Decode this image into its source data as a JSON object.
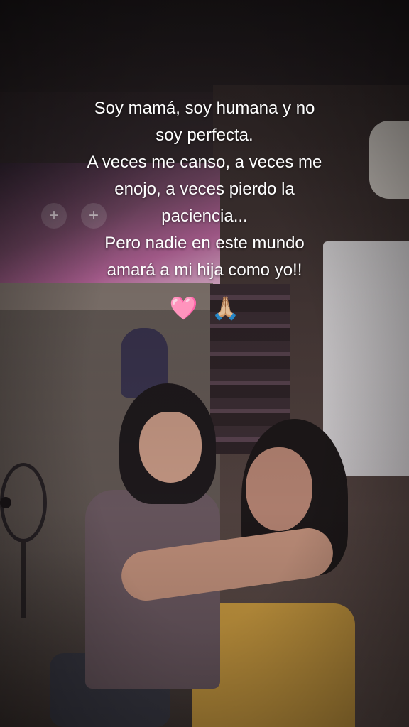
{
  "caption": {
    "lines": [
      "Soy mamá, soy humana y no",
      "soy perfecta.",
      "A veces me canso, a veces me",
      "enojo, a veces pierdo la",
      "paciencia...",
      "Pero nadie en este mundo",
      "amará a mi hija como yo!!"
    ]
  },
  "emojis": {
    "heart": "🩷",
    "hands": "🙏🏼",
    "heart_icon": "pink-heart-icon",
    "hands_icon": "folded-hands-icon"
  },
  "tv": {
    "plus_1": "+",
    "plus_2": "+"
  }
}
